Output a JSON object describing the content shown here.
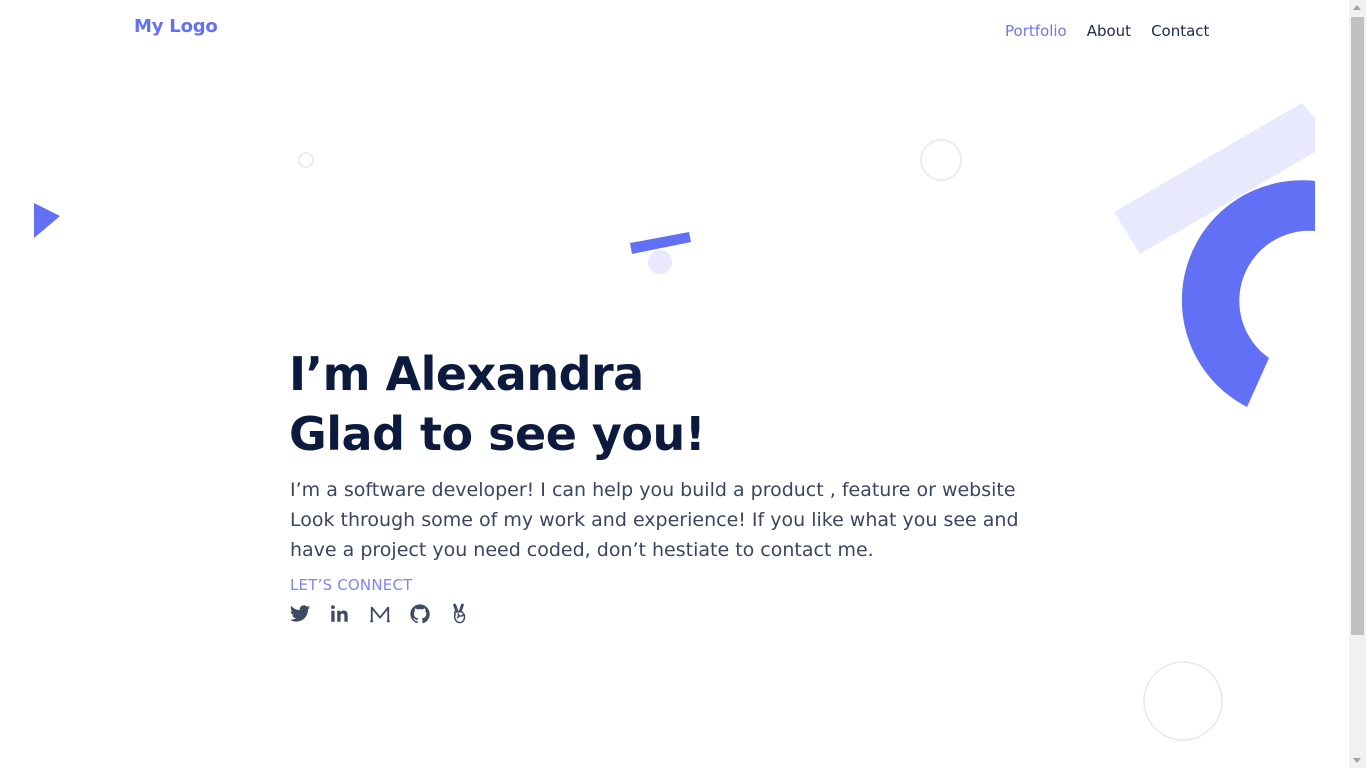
{
  "header": {
    "logo": "My Logo",
    "nav": [
      {
        "label": "Portfolio",
        "active": true
      },
      {
        "label": "About",
        "active": false
      },
      {
        "label": "Contact",
        "active": false
      }
    ]
  },
  "hero": {
    "heading_line1": "I’m Alexandra",
    "heading_line2": "Glad to see you!",
    "intro_line1": "I’m a software developer! I can help you build a product , feature or website",
    "intro_line2": "Look through some of my work and experience! If you like what you see and",
    "intro_line3": "have a project you need coded, don’t hestiate to contact me.",
    "connect_label": "LET’S CONNECT",
    "social_icons": [
      "twitter-icon",
      "linkedin-icon",
      "medium-icon",
      "github-icon",
      "angellist-icon"
    ]
  },
  "colors": {
    "accent": "#6270f5",
    "nav_active": "#6d75f0",
    "heading": "#0c1a3d",
    "body_text": "#3a4560",
    "connect": "#7e86f3",
    "icon": "#3e4a63",
    "light_accent": "#e8e9fd"
  }
}
